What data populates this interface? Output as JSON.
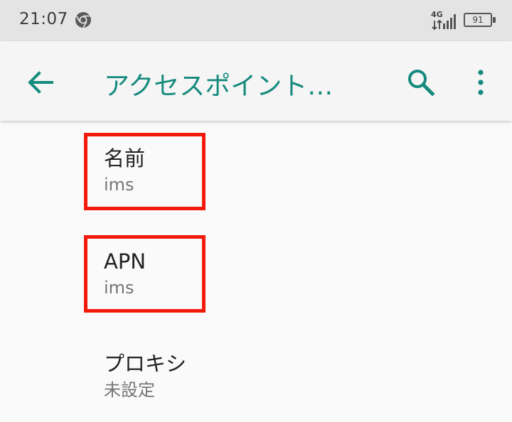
{
  "status_bar": {
    "time": "21:07",
    "network": "4G",
    "battery": "91",
    "icons": [
      "chrome-icon",
      "data-arrows-icon",
      "signal-icon",
      "battery-icon"
    ]
  },
  "app_bar": {
    "title": "アクセスポイント…",
    "icons": [
      "back-arrow-icon",
      "search-icon",
      "more-vert-icon"
    ]
  },
  "settings": [
    {
      "title": "名前",
      "summary": "ims"
    },
    {
      "title": "APN",
      "summary": "ims"
    },
    {
      "title": "プロキシ",
      "summary": "未設定"
    }
  ],
  "colors": {
    "accent": "#158a7d",
    "highlight": "#f21a0a",
    "status_bar_bg": "#e4e4e4",
    "app_bar_bg": "#f5f5f5",
    "page_bg": "#fafafa"
  }
}
